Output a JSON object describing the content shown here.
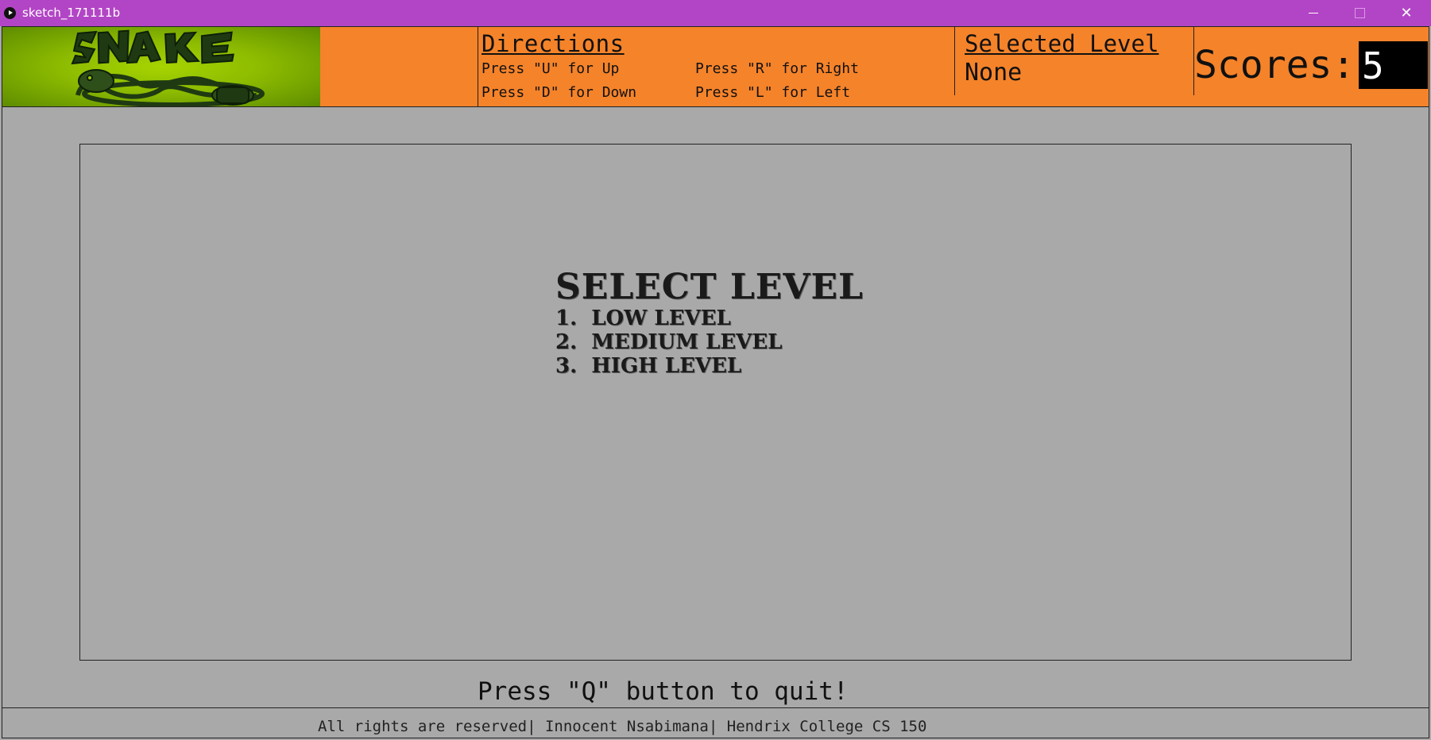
{
  "window": {
    "title": "sketch_171111b",
    "minimize_glyph": "",
    "maximize_glyph": "",
    "close_glyph": "✕"
  },
  "header": {
    "logo_icon": "snake-logo-icon",
    "directions": {
      "title": "Directions",
      "up": "Press \"U\" for Up",
      "down": "Press \"D\" for Down",
      "right": "Press \"R\" for Right",
      "left": "Press \"L\" for Left"
    },
    "selected_level": {
      "title": "Selected Level",
      "value": "None"
    },
    "scores": {
      "label": "Scores:",
      "value": "5"
    }
  },
  "menu": {
    "title": "SELECT LEVEL",
    "items": [
      "1.  LOW LEVEL",
      "2.  MEDIUM LEVEL",
      "3.  HIGH LEVEL"
    ]
  },
  "quit_text": "Press \"Q\" button to quit!",
  "footer": "All rights are reserved| Innocent Nsabimana| Hendrix College CS 150",
  "colors": {
    "titlebar": "#b245c5",
    "header": "#f5832a",
    "background": "#a9a9a9",
    "logo_green": "#8dbb00"
  }
}
